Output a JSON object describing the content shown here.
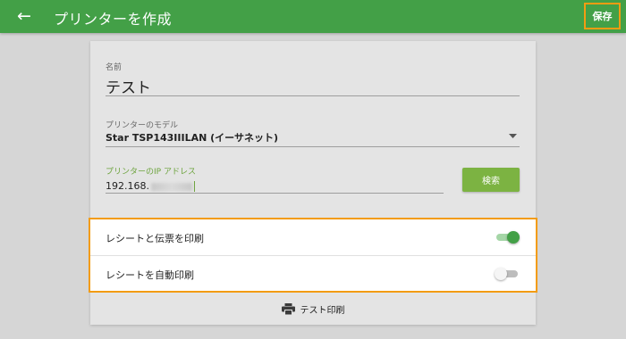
{
  "appbar": {
    "back_icon": "arrow-left-icon",
    "title": "プリンターを作成",
    "save_label": "保存"
  },
  "form": {
    "name": {
      "label": "名前",
      "value": "テスト"
    },
    "model": {
      "label": "プリンターのモデル",
      "value": "Star TSP143IIILAN (イーサネット)"
    },
    "ip": {
      "label": "プリンターのIP アドレス",
      "value": "192.168."
    },
    "search_label": "検索"
  },
  "settings": {
    "items": [
      {
        "label": "レシートと伝票を印刷",
        "enabled": true
      },
      {
        "label": "レシートを自動印刷",
        "enabled": false
      }
    ]
  },
  "test_print": {
    "icon": "printer-icon",
    "label": "テスト印刷"
  },
  "colors": {
    "appbar": "#43a047",
    "accent": "#7cb342",
    "highlight": "#f39c12",
    "background": "#d6d6d6"
  }
}
